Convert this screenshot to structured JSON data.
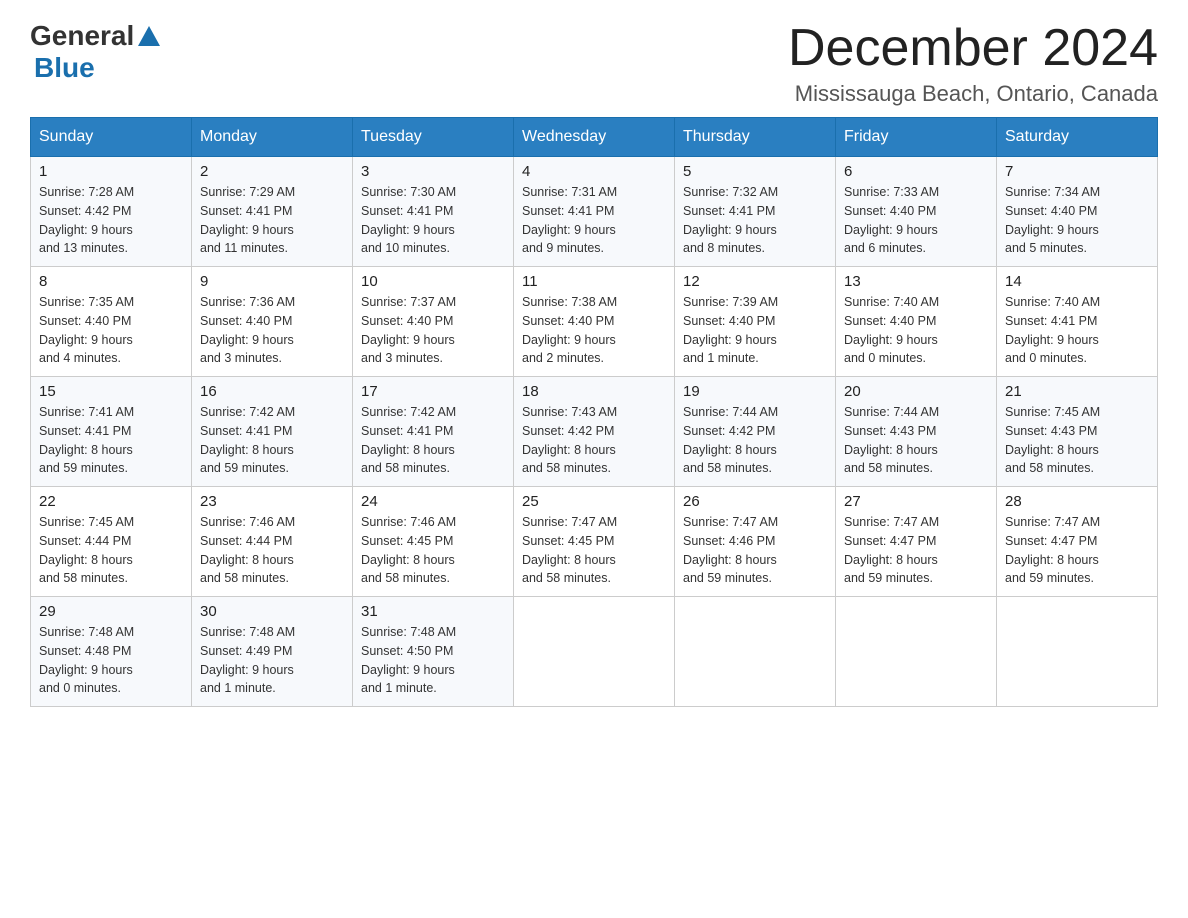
{
  "logo": {
    "general": "General",
    "blue": "Blue"
  },
  "title": "December 2024",
  "location": "Mississauga Beach, Ontario, Canada",
  "headers": [
    "Sunday",
    "Monday",
    "Tuesday",
    "Wednesday",
    "Thursday",
    "Friday",
    "Saturday"
  ],
  "weeks": [
    [
      {
        "day": "1",
        "sunrise": "7:28 AM",
        "sunset": "4:42 PM",
        "daylight": "9 hours and 13 minutes."
      },
      {
        "day": "2",
        "sunrise": "7:29 AM",
        "sunset": "4:41 PM",
        "daylight": "9 hours and 11 minutes."
      },
      {
        "day": "3",
        "sunrise": "7:30 AM",
        "sunset": "4:41 PM",
        "daylight": "9 hours and 10 minutes."
      },
      {
        "day": "4",
        "sunrise": "7:31 AM",
        "sunset": "4:41 PM",
        "daylight": "9 hours and 9 minutes."
      },
      {
        "day": "5",
        "sunrise": "7:32 AM",
        "sunset": "4:41 PM",
        "daylight": "9 hours and 8 minutes."
      },
      {
        "day": "6",
        "sunrise": "7:33 AM",
        "sunset": "4:40 PM",
        "daylight": "9 hours and 6 minutes."
      },
      {
        "day": "7",
        "sunrise": "7:34 AM",
        "sunset": "4:40 PM",
        "daylight": "9 hours and 5 minutes."
      }
    ],
    [
      {
        "day": "8",
        "sunrise": "7:35 AM",
        "sunset": "4:40 PM",
        "daylight": "9 hours and 4 minutes."
      },
      {
        "day": "9",
        "sunrise": "7:36 AM",
        "sunset": "4:40 PM",
        "daylight": "9 hours and 3 minutes."
      },
      {
        "day": "10",
        "sunrise": "7:37 AM",
        "sunset": "4:40 PM",
        "daylight": "9 hours and 3 minutes."
      },
      {
        "day": "11",
        "sunrise": "7:38 AM",
        "sunset": "4:40 PM",
        "daylight": "9 hours and 2 minutes."
      },
      {
        "day": "12",
        "sunrise": "7:39 AM",
        "sunset": "4:40 PM",
        "daylight": "9 hours and 1 minute."
      },
      {
        "day": "13",
        "sunrise": "7:40 AM",
        "sunset": "4:40 PM",
        "daylight": "9 hours and 0 minutes."
      },
      {
        "day": "14",
        "sunrise": "7:40 AM",
        "sunset": "4:41 PM",
        "daylight": "9 hours and 0 minutes."
      }
    ],
    [
      {
        "day": "15",
        "sunrise": "7:41 AM",
        "sunset": "4:41 PM",
        "daylight": "8 hours and 59 minutes."
      },
      {
        "day": "16",
        "sunrise": "7:42 AM",
        "sunset": "4:41 PM",
        "daylight": "8 hours and 59 minutes."
      },
      {
        "day": "17",
        "sunrise": "7:42 AM",
        "sunset": "4:41 PM",
        "daylight": "8 hours and 58 minutes."
      },
      {
        "day": "18",
        "sunrise": "7:43 AM",
        "sunset": "4:42 PM",
        "daylight": "8 hours and 58 minutes."
      },
      {
        "day": "19",
        "sunrise": "7:44 AM",
        "sunset": "4:42 PM",
        "daylight": "8 hours and 58 minutes."
      },
      {
        "day": "20",
        "sunrise": "7:44 AM",
        "sunset": "4:43 PM",
        "daylight": "8 hours and 58 minutes."
      },
      {
        "day": "21",
        "sunrise": "7:45 AM",
        "sunset": "4:43 PM",
        "daylight": "8 hours and 58 minutes."
      }
    ],
    [
      {
        "day": "22",
        "sunrise": "7:45 AM",
        "sunset": "4:44 PM",
        "daylight": "8 hours and 58 minutes."
      },
      {
        "day": "23",
        "sunrise": "7:46 AM",
        "sunset": "4:44 PM",
        "daylight": "8 hours and 58 minutes."
      },
      {
        "day": "24",
        "sunrise": "7:46 AM",
        "sunset": "4:45 PM",
        "daylight": "8 hours and 58 minutes."
      },
      {
        "day": "25",
        "sunrise": "7:47 AM",
        "sunset": "4:45 PM",
        "daylight": "8 hours and 58 minutes."
      },
      {
        "day": "26",
        "sunrise": "7:47 AM",
        "sunset": "4:46 PM",
        "daylight": "8 hours and 59 minutes."
      },
      {
        "day": "27",
        "sunrise": "7:47 AM",
        "sunset": "4:47 PM",
        "daylight": "8 hours and 59 minutes."
      },
      {
        "day": "28",
        "sunrise": "7:47 AM",
        "sunset": "4:47 PM",
        "daylight": "8 hours and 59 minutes."
      }
    ],
    [
      {
        "day": "29",
        "sunrise": "7:48 AM",
        "sunset": "4:48 PM",
        "daylight": "9 hours and 0 minutes."
      },
      {
        "day": "30",
        "sunrise": "7:48 AM",
        "sunset": "4:49 PM",
        "daylight": "9 hours and 1 minute."
      },
      {
        "day": "31",
        "sunrise": "7:48 AM",
        "sunset": "4:50 PM",
        "daylight": "9 hours and 1 minute."
      },
      null,
      null,
      null,
      null
    ]
  ],
  "labels": {
    "sunrise": "Sunrise:",
    "sunset": "Sunset:",
    "daylight": "Daylight:"
  }
}
